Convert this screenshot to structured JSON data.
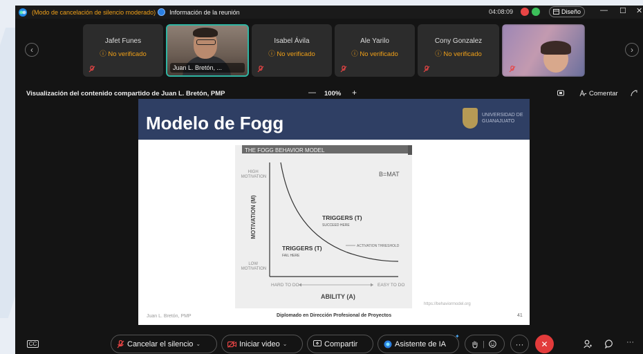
{
  "titlebar": {
    "mode": "(Modo de cancelación de silencio moderado)",
    "info": "Información de la reunión",
    "time": "04:08:09",
    "layout": "Diseño",
    "minimize": "—",
    "maximize": "☐",
    "close": "✕"
  },
  "participants": [
    {
      "name": "Jafet Funes",
      "status": "ⓘ No verificado"
    },
    {
      "name": "Juan L. Bretón, ...",
      "status": ""
    },
    {
      "name": "Isabel Ávila",
      "status": "ⓘ No verificado"
    },
    {
      "name": "Ale Yarilo",
      "status": "ⓘ No verificado"
    },
    {
      "name": "Cony Gonzalez",
      "status": "ⓘ No verificado"
    }
  ],
  "nav": {
    "prev": "‹",
    "next": "›"
  },
  "share": {
    "title": "Visualización del contenido compartido de Juan L. Bretón, PMP",
    "zoom_out": "—",
    "zoom": "100%",
    "zoom_in": "+",
    "comment": "Comentar"
  },
  "slide": {
    "title": "Modelo de Fogg",
    "university": "UNIVERSIDAD DE\nGUANAJUATO",
    "footer_left": "Juan L. Bretón, PMP",
    "footer_center": "Diplomado en Dirección Profesional de Proyectos",
    "footer_url": "https://behaviormodel.org",
    "page": "41"
  },
  "figure": {
    "header": "THE FOGG BEHAVIOR MODEL",
    "formula": "B=MAT",
    "high_motivation": "HIGH\nMOTIVATION",
    "low_motivation": "LOW\nMOTIVATION",
    "y_axis": "MOTIVATION (M)",
    "x_axis": "ABILITY (A)",
    "hard": "HARD TO DO",
    "easy": "EASY TO DO",
    "triggers_succeed": "TRIGGERS (T)",
    "succeed_sub": "SUCCEED HERE",
    "triggers_fail": "TRIGGERS (T)",
    "fail_sub": "FAIL HERE",
    "threshold": "ACTIVATION THRESHOLD"
  },
  "toolbar": {
    "captions": "CC",
    "unmute": "Cancelar el silencio",
    "video": "Iniciar video",
    "share": "Compartir",
    "ai": "Asistente de IA",
    "more": "···",
    "end": "✕",
    "more2": "···"
  },
  "colors": {
    "accent_orange": "#f0a018",
    "active_border": "#2fb5a3",
    "slide_header": "#2f3f64",
    "end_call": "#e23b3b"
  }
}
